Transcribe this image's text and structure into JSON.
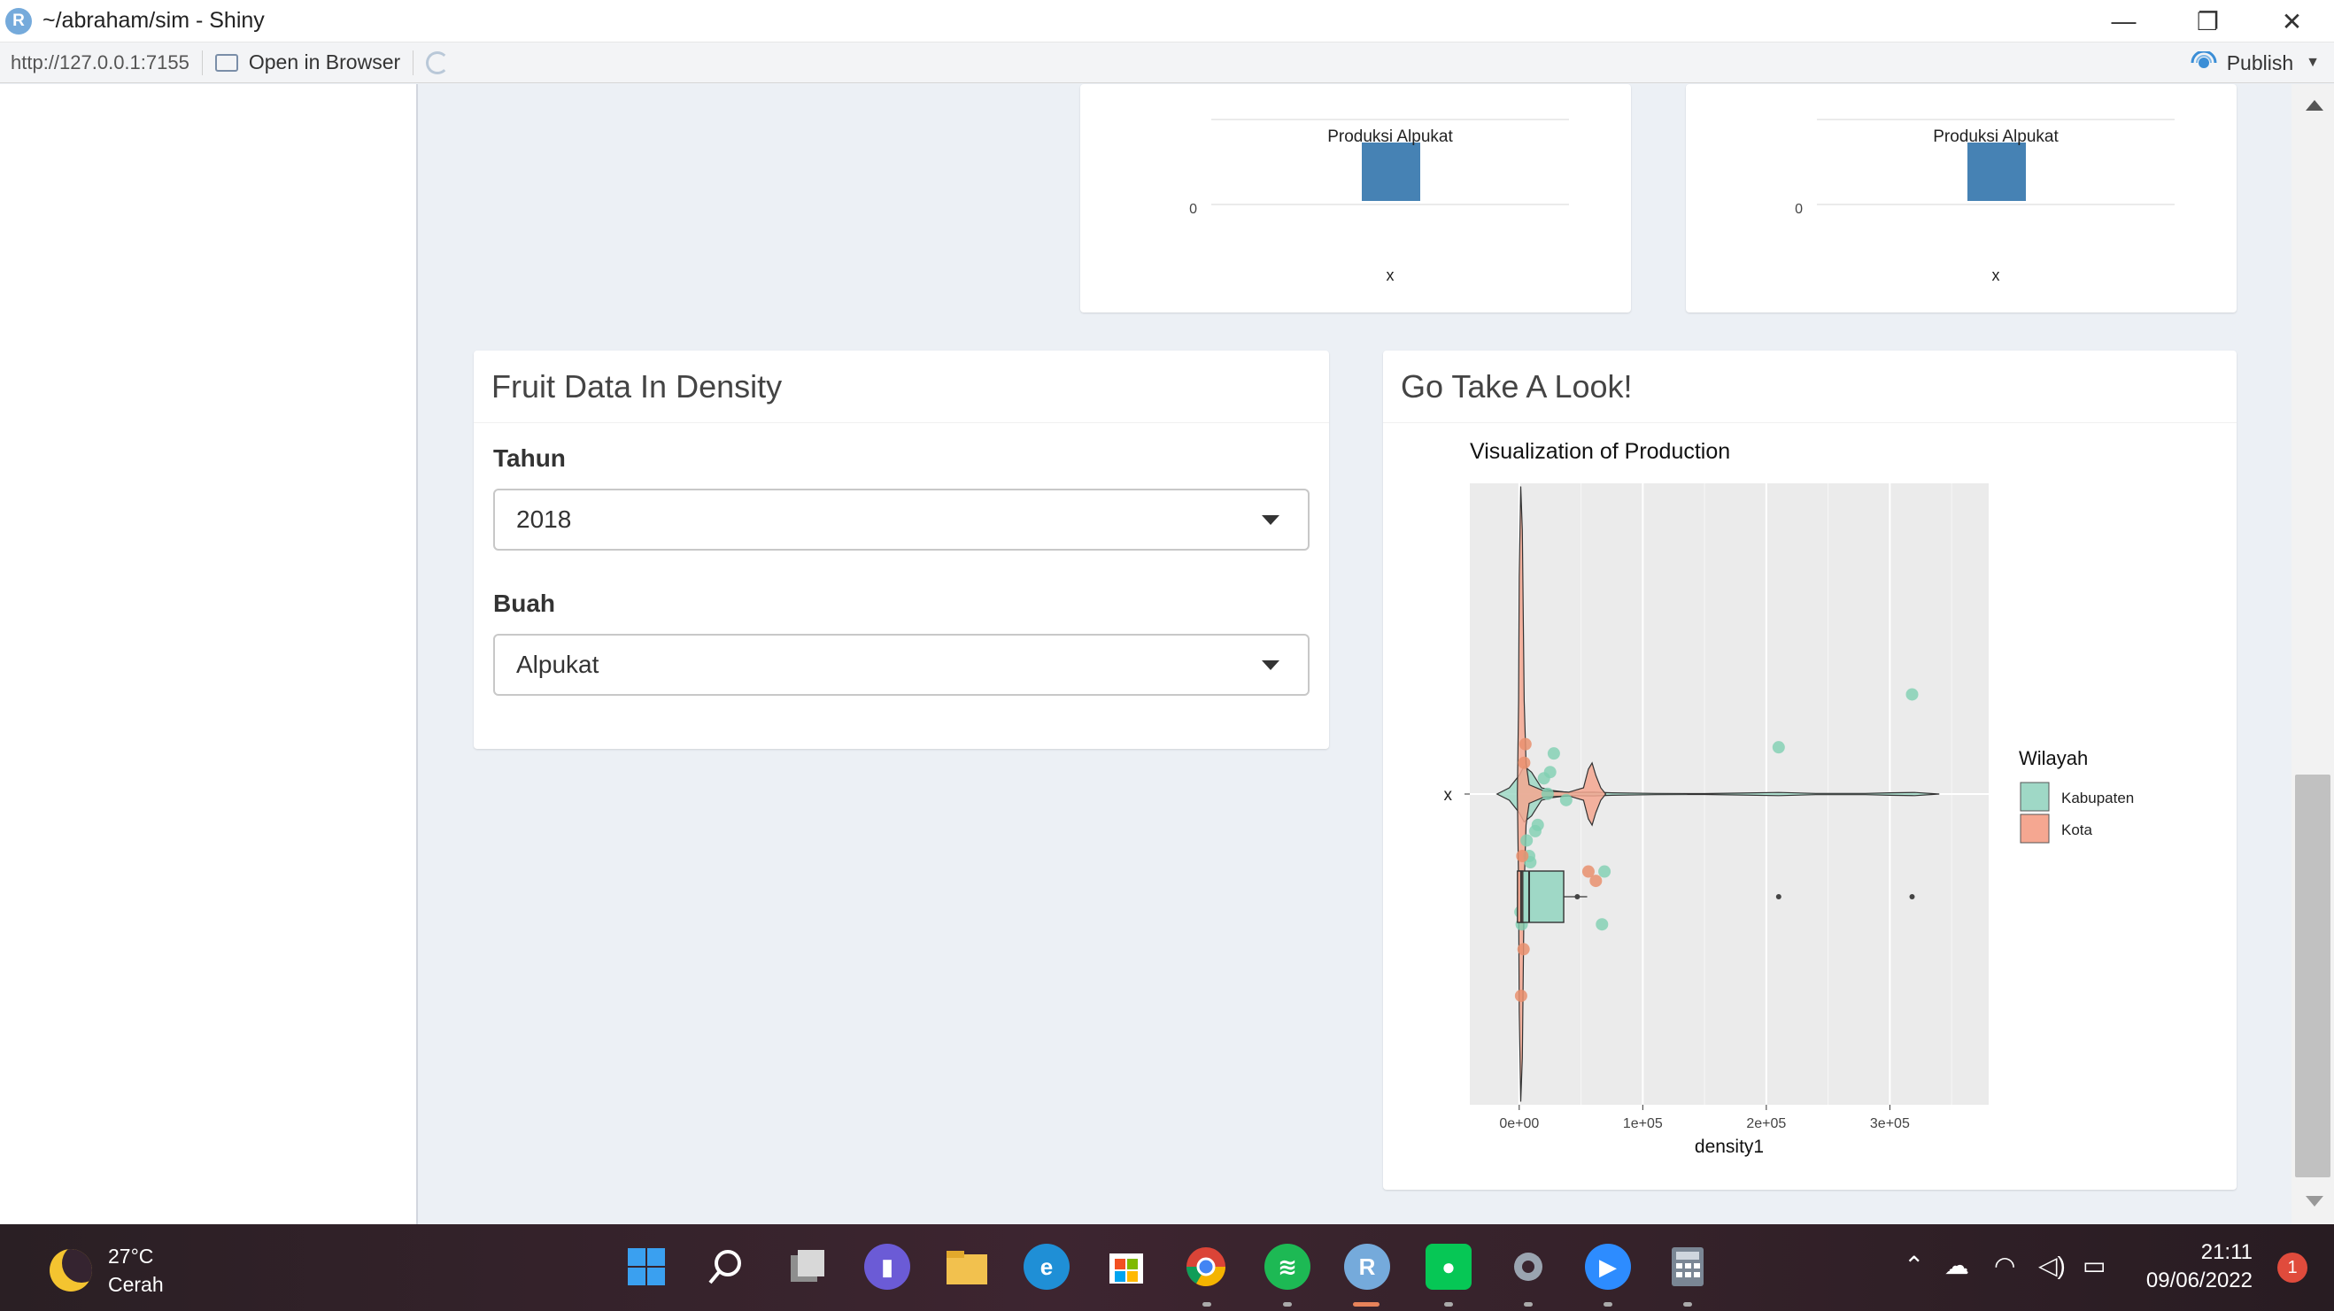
{
  "window": {
    "title": "~/abraham/sim - Shiny",
    "app_icon_letter": "R",
    "controls": {
      "minimize": "—",
      "restore": "❐",
      "close": "✕"
    }
  },
  "toolbar": {
    "url": "http://127.0.0.1:7155",
    "open_in_browser": "Open in Browser",
    "publish": "Publish"
  },
  "top_cards": [
    {
      "title": "Produksi Alpukat",
      "y_tick": "0",
      "x_label": "x"
    },
    {
      "title": "Produksi Alpukat",
      "y_tick": "0",
      "x_label": "x"
    }
  ],
  "density_box": {
    "title": "Fruit Data In Density",
    "tahun_label": "Tahun",
    "tahun_value": "2018",
    "buah_label": "Buah",
    "buah_value": "Alpukat"
  },
  "look_box": {
    "title": "Go Take A Look!"
  },
  "chart_data": {
    "type": "violin",
    "title": "Visualization of Production",
    "xlabel": "density1",
    "ylabel": "",
    "y_tick": "x",
    "x_ticks": [
      "0e+00",
      "1e+05",
      "2e+05",
      "3e+05"
    ],
    "xlim": [
      -40000,
      380000
    ],
    "legend": {
      "title": "Wilayah",
      "position": "right",
      "entries": [
        {
          "name": "Kabupaten",
          "color": "#9fd8c6"
        },
        {
          "name": "Kota",
          "color": "#f5a791"
        }
      ]
    },
    "background": "#ebebeb",
    "grid": true,
    "points_kabupaten": [
      [
        3000,
        -0.12
      ],
      [
        6000,
        0.05
      ],
      [
        9000,
        -0.02
      ],
      [
        13000,
        0.08
      ],
      [
        15000,
        0.1
      ],
      [
        20000,
        0.25
      ],
      [
        25000,
        0.27
      ],
      [
        28000,
        0.33
      ],
      [
        38000,
        0.18
      ],
      [
        23000,
        0.2
      ],
      [
        1000,
        -0.18
      ],
      [
        4000,
        -0.08
      ],
      [
        2000,
        -0.22
      ],
      [
        69000,
        -0.05
      ],
      [
        67000,
        -0.22
      ],
      [
        210000,
        0.35
      ],
      [
        318000,
        0.52
      ],
      [
        8000,
        0.0
      ]
    ],
    "points_kota": [
      [
        2500,
        0.0
      ],
      [
        4000,
        0.3
      ],
      [
        5000,
        0.36
      ],
      [
        56000,
        -0.05
      ],
      [
        62000,
        -0.08
      ],
      [
        3500,
        -0.3
      ],
      [
        1500,
        -0.45
      ]
    ],
    "boxplot_kabupaten": {
      "q1": 0,
      "median": 8000,
      "q3": 36000,
      "whisker_high": 55000,
      "outliers": [
        210000,
        318000
      ]
    },
    "boxplot_kota": {
      "q1": 0,
      "median": 1500,
      "q3": 3000
    }
  }
}
